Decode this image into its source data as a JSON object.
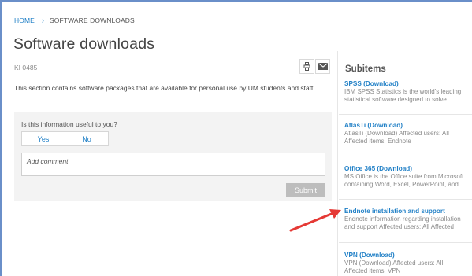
{
  "breadcrumb": {
    "home": "HOME",
    "separator": "›",
    "current": "SOFTWARE DOWNLOADS"
  },
  "page": {
    "title": "Software downloads",
    "ki_number": "KI 0485",
    "description": "This section contains software packages that are available for personal use by UM students and staff."
  },
  "icons": {
    "print": "print-icon",
    "mail": "mail-icon"
  },
  "feedback": {
    "question": "Is this information useful to you?",
    "yes_label": "Yes",
    "no_label": "No",
    "comment_placeholder": "Add comment",
    "submit_label": "Submit"
  },
  "subitems": {
    "heading": "Subitems",
    "items": [
      {
        "title": "SPSS (Download)",
        "line1": "IBM SPSS Statistics is the world's leading",
        "line2": "statistical software designed to solve"
      },
      {
        "title": "AtlasTi (Download)",
        "line1": "AtlasTi (Download) Affected users: All",
        "line2": "Affected items: Endnote"
      },
      {
        "title": "Office 365 (Download)",
        "line1": "MS Office is the Office suite from Microsoft",
        "line2": "containing Word, Excel, PowerPoint, and"
      },
      {
        "title": "Endnote installation and support",
        "line1": "Endnote information regarding installation",
        "line2": "and support Affected users: All Affected"
      },
      {
        "title": "VPN (Download)",
        "line1": "VPN (Download) Affected users: All",
        "line2": "Affected items: VPN"
      }
    ]
  },
  "colors": {
    "link": "#1f7fc6",
    "frame": "#6a8fc9",
    "arrow": "#e53935",
    "panel": "#f3f3f3"
  }
}
